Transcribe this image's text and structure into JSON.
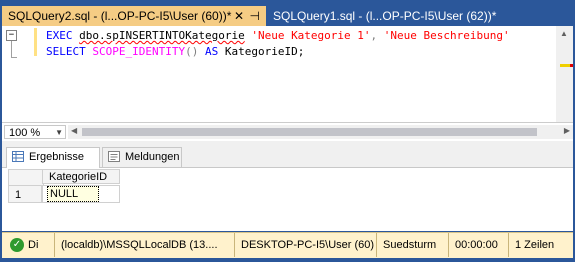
{
  "tabs": [
    {
      "title": "SQLQuery2.sql - (l...OP-PC-I5\\User (60))*",
      "active": true
    },
    {
      "title": "SQLQuery1.sql - (l...OP-PC-I5\\User (62))*",
      "active": false
    }
  ],
  "pin_icon": "pin-icon",
  "close_icon": "close-icon",
  "editor": {
    "line1": {
      "kw": "EXEC",
      "proc": "dbo.spINSERTINTOKategorie",
      "arg1": "'Neue Kategorie 1'",
      "sep": ", ",
      "arg2": "'Neue Beschreibung'"
    },
    "line2": {
      "kw1": "SELECT",
      "fn": "SCOPE_IDENTITY",
      "paren": "()",
      "kw2": "AS",
      "alias": "KategorieID;"
    }
  },
  "zoom": "100 %",
  "results": {
    "tabs": [
      "Ergebnisse",
      "Meldungen"
    ],
    "column": "KategorieID",
    "row_number": "1",
    "value": "NULL"
  },
  "status": {
    "state": "Di",
    "server": "(localdb)\\MSSQLLocalDB (13....",
    "user": "DESKTOP-PC-I5\\User (60)",
    "database": "Suedsturm",
    "time": "00:00:00",
    "rows": "1 Zeilen"
  },
  "colors": {
    "window_bg": "#2b579a",
    "active_tab": "#f5cc84",
    "status_bar": "#fff2cc",
    "keyword": "#0000ff",
    "function": "#ff00ff",
    "string": "#ff0000"
  }
}
